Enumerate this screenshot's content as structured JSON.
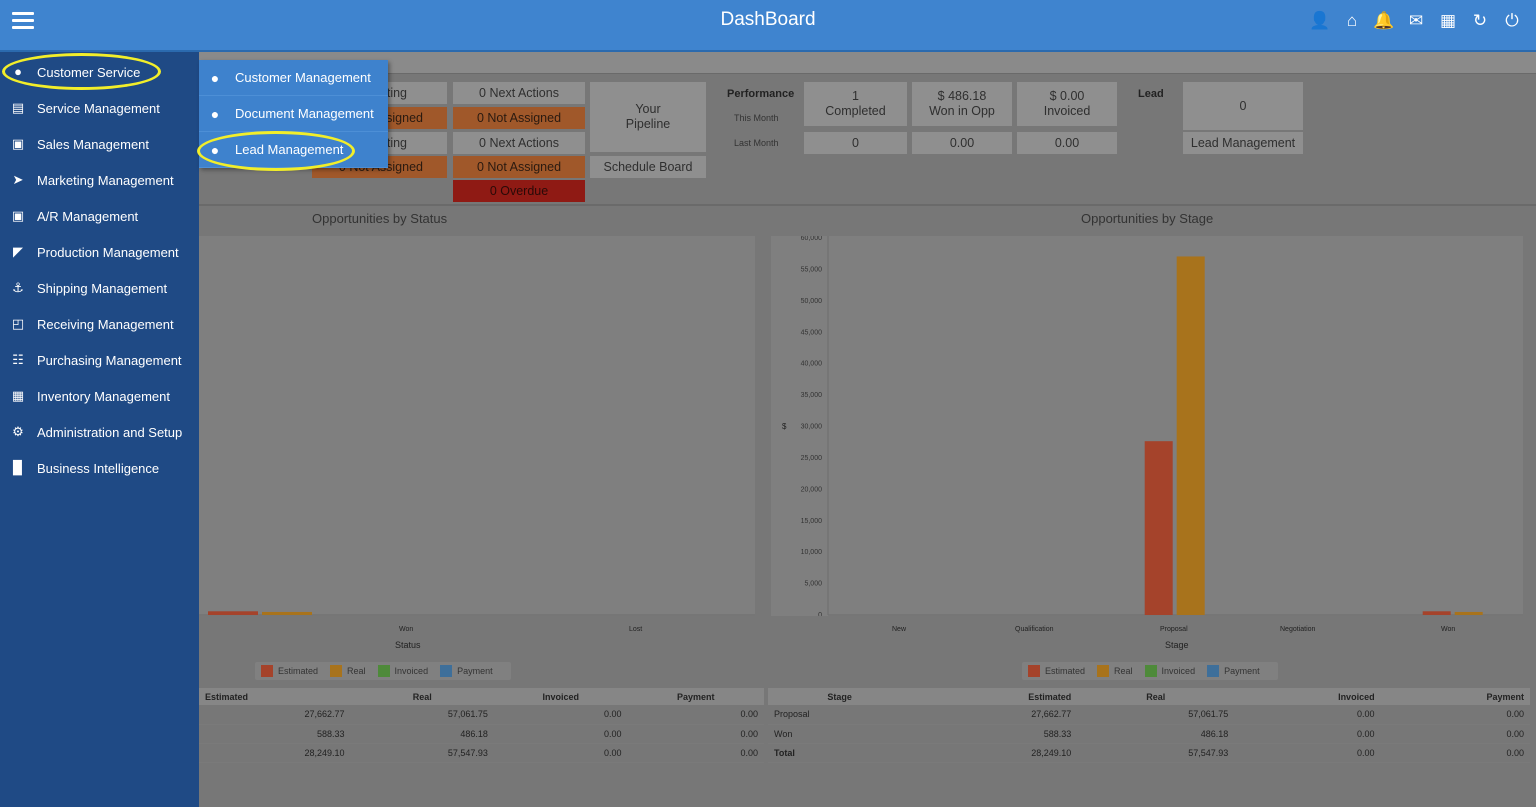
{
  "header": {
    "title": "DashBoard",
    "icons": [
      "user-icon",
      "home-icon",
      "bell-icon",
      "mail-icon",
      "calendar-icon",
      "refresh-icon",
      "power-icon"
    ]
  },
  "sidebar": {
    "items": [
      {
        "label": "Customer Service",
        "icon": "users-icon"
      },
      {
        "label": "Service Management",
        "icon": "server-icon"
      },
      {
        "label": "Sales Management",
        "icon": "briefcase-icon"
      },
      {
        "label": "Marketing Management",
        "icon": "arrow-circle-icon"
      },
      {
        "label": "A/R Management",
        "icon": "briefcase-icon"
      },
      {
        "label": "Production Management",
        "icon": "factory-icon"
      },
      {
        "label": "Shipping Management",
        "icon": "ship-icon"
      },
      {
        "label": "Receiving Management",
        "icon": "basket-icon"
      },
      {
        "label": "Purchasing Management",
        "icon": "cart-icon"
      },
      {
        "label": "Inventory Management",
        "icon": "building-icon"
      },
      {
        "label": "Administration and Setup",
        "icon": "gears-icon"
      },
      {
        "label": "Business Intelligence",
        "icon": "bar-chart-icon"
      }
    ]
  },
  "flyout": {
    "items": [
      {
        "label": "Customer Management"
      },
      {
        "label": "Document Management"
      },
      {
        "label": "Lead Management"
      }
    ]
  },
  "actions": {
    "r1_partial": "ting",
    "r1_next": "0 Next Actions",
    "r2_partial": "signed",
    "r2_not": "0 Not Assigned",
    "r3_partial": "ting",
    "r3_next": "0 Next Actions",
    "r4_partial": "0 Not Assigned",
    "r4_not": "0 Not Assigned",
    "overdue": "0 Overdue",
    "pipeline": "Your Pipeline",
    "schedule": "Schedule Board"
  },
  "performance": {
    "label": "Performance",
    "this_month": "This Month",
    "last_month": "Last Month",
    "completed": "1 Completed",
    "won": "$ 486.18 Won in Opp",
    "invoiced": "$ 0.00 Invoiced",
    "last_completed": "0",
    "last_won": "0.00",
    "last_invoiced": "0.00"
  },
  "lead": {
    "label": "Lead",
    "count": "0",
    "button": "Lead Management"
  },
  "chart_data": [
    {
      "type": "bar",
      "title": "Opportunities by Status",
      "xlabel": "Status",
      "categories": [
        "Won",
        "Lost"
      ],
      "series": [
        {
          "name": "Estimated",
          "values": [
            588.33,
            0
          ]
        },
        {
          "name": "Real",
          "values": [
            486.18,
            0
          ]
        },
        {
          "name": "Invoiced",
          "values": [
            0,
            0
          ]
        },
        {
          "name": "Payment",
          "values": [
            0,
            0
          ]
        }
      ]
    },
    {
      "type": "bar",
      "title": "Opportunities by Stage",
      "xlabel": "Stage",
      "ylabel": "$",
      "ylim": [
        0,
        60000
      ],
      "yticks": [
        "60,000",
        "55,000",
        "50,000",
        "45,000",
        "40,000",
        "35,000",
        "30,000",
        "25,000",
        "20,000",
        "15,000",
        "10,000",
        "5,000",
        "0"
      ],
      "categories": [
        "New",
        "Qualification",
        "Proposal",
        "Negotiation",
        "Won"
      ],
      "series": [
        {
          "name": "Estimated",
          "values": [
            0,
            0,
            27662.77,
            0,
            588.33
          ]
        },
        {
          "name": "Real",
          "values": [
            0,
            0,
            57061.75,
            0,
            486.18
          ]
        },
        {
          "name": "Invoiced",
          "values": [
            0,
            0,
            0,
            0,
            0
          ]
        },
        {
          "name": "Payment",
          "values": [
            0,
            0,
            0,
            0,
            0
          ]
        }
      ]
    }
  ],
  "colors": {
    "estimated": "#a5432b",
    "real": "#a8731c",
    "invoiced": "#4e8a3a",
    "payment": "#3e6f9a"
  },
  "legend": {
    "estimated": "Estimated",
    "real": "Real",
    "invoiced": "Invoiced",
    "payment": "Payment"
  },
  "table_status": {
    "headers": [
      "Estimated",
      "Real",
      "Invoiced",
      "Payment"
    ],
    "rows": [
      [
        "27,662.77",
        "57,061.75",
        "0.00",
        "0.00"
      ],
      [
        "588.33",
        "486.18",
        "0.00",
        "0.00"
      ],
      [
        "28,249.10",
        "57,547.93",
        "0.00",
        "0.00"
      ]
    ]
  },
  "table_stage": {
    "headers": [
      "Stage",
      "Estimated",
      "Real",
      "Invoiced",
      "Payment"
    ],
    "rows": [
      [
        "Proposal",
        "27,662.77",
        "57,061.75",
        "0.00",
        "0.00"
      ],
      [
        "Won",
        "588.33",
        "486.18",
        "0.00",
        "0.00"
      ],
      [
        "Total",
        "28,249.10",
        "57,547.93",
        "0.00",
        "0.00"
      ]
    ]
  }
}
